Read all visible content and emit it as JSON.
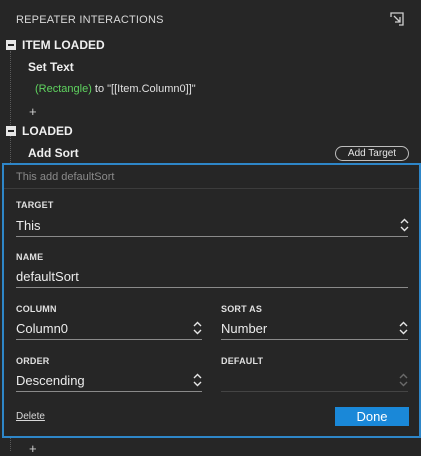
{
  "header": {
    "title": "REPEATER INTERACTIONS",
    "corner_icon": "collapse-arrow-icon"
  },
  "sections": [
    {
      "label": "ITEM LOADED",
      "action": "Set Text",
      "detail_target": "(Rectangle)",
      "detail_text": " to \"[[Item.Column0]]\""
    },
    {
      "label": "LOADED",
      "action": "Add Sort",
      "add_target_label": "Add Target"
    }
  ],
  "add_plus": "+",
  "panel": {
    "subtitle": "This add defaultSort",
    "target": {
      "label": "TARGET",
      "value": "This"
    },
    "name": {
      "label": "NAME",
      "value": "defaultSort"
    },
    "column": {
      "label": "COLUMN",
      "value": "Column0"
    },
    "sort_as": {
      "label": "SORT AS",
      "value": "Number"
    },
    "order": {
      "label": "ORDER",
      "value": "Descending"
    },
    "default": {
      "label": "DEFAULT",
      "value": ""
    },
    "delete_label": "Delete",
    "done_label": "Done"
  },
  "colors": {
    "accent": "#1a88d8",
    "panel_border": "#2e86c8",
    "green": "#5fd35f",
    "background": "#262626"
  }
}
